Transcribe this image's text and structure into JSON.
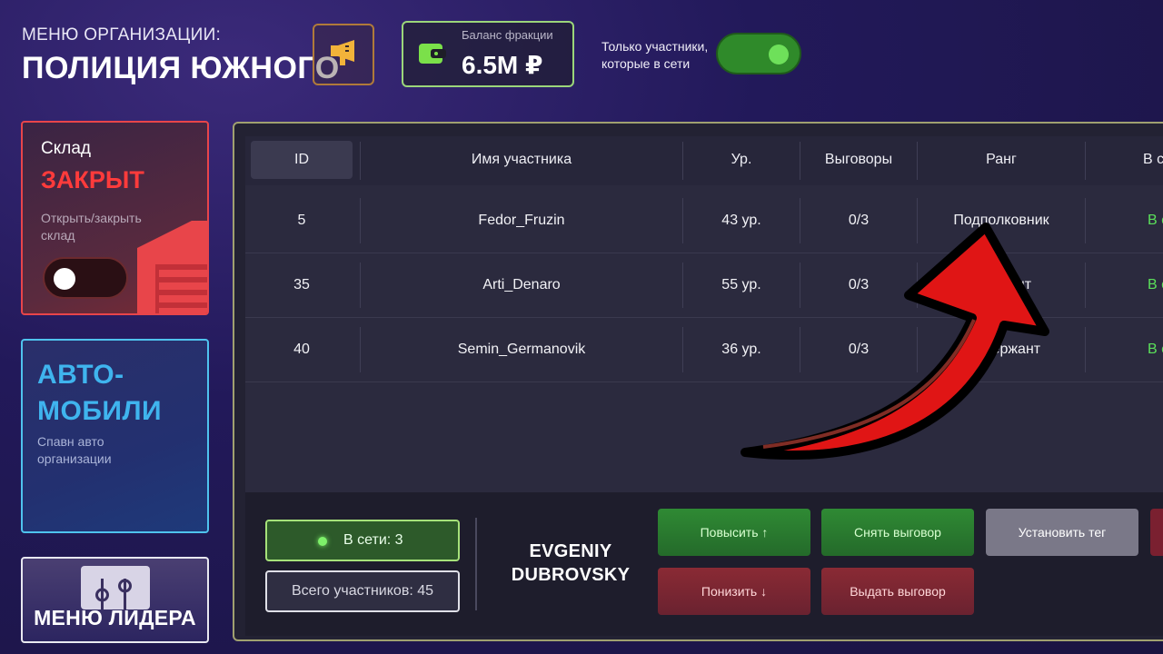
{
  "header": {
    "subtitle": "МЕНЮ ОРГАНИЗАЦИИ:",
    "title": "ПОЛИЦИЯ ЮЖНОГО",
    "megaphone_icon": "megaphone-icon",
    "balance": {
      "label": "Баланс фракции",
      "value": "6.5M ₽",
      "icon": "wallet-icon"
    },
    "online_only": {
      "label_line1": "Только участники,",
      "label_line2": "которые в сети",
      "enabled": true
    }
  },
  "sidebar": {
    "warehouse": {
      "label": "Склад",
      "status": "ЗАКРЫТ",
      "description": "Открыть/закрыть склад",
      "toggle_on": false,
      "status_color": "#ff3b3b"
    },
    "cars": {
      "title_line1": "АВТО-",
      "title_line2": "МОБИЛИ",
      "description": "Спавн авто организации"
    },
    "leader": {
      "title": "МЕНЮ ЛИДЕРА",
      "icon": "sliders-icon"
    }
  },
  "table": {
    "columns": [
      "ID",
      "Имя участника",
      "Ур.",
      "Выговоры",
      "Ранг",
      "В с"
    ],
    "rows": [
      {
        "id": "5",
        "name": "Fedor_Fruzin",
        "level": "43 ур.",
        "warnings": "0/3",
        "rank": "Подполковник",
        "status": "В с"
      },
      {
        "id": "35",
        "name": "Arti_Denaro",
        "level": "55 ур.",
        "warnings": "0/3",
        "rank": "ант",
        "status": "В с"
      },
      {
        "id": "40",
        "name": "Semin_Germanovik",
        "level": "36 ур.",
        "warnings": "0/3",
        "rank": "Сержант",
        "status": "В с"
      }
    ]
  },
  "footer": {
    "online": "В сети: 3",
    "total": "Всего участников: 45",
    "player_line1": "EVGENIY",
    "player_line2": "DUBROVSKY",
    "buttons": {
      "promote": "Повысить ↑",
      "remove_warning": "Снять выговор",
      "set_tag": "Установить тег",
      "demote": "Понизить ↓",
      "give_warning": "Выдать выговор"
    }
  },
  "colors": {
    "accent_green": "#5be05a",
    "accent_red": "#ff3b3b",
    "accent_blue": "#3fb4ee",
    "panel_border": "#a0a070"
  }
}
